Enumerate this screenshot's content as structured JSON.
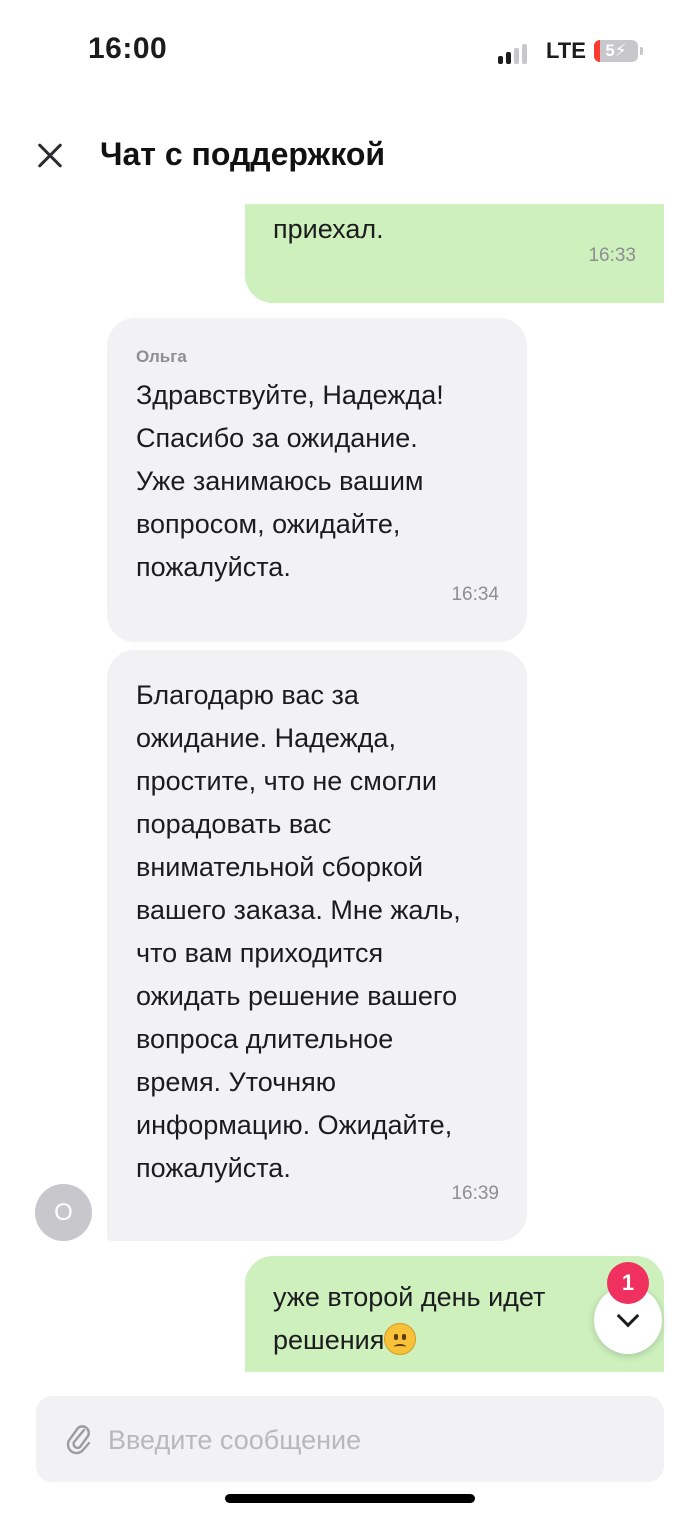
{
  "status_bar": {
    "time": "16:00",
    "network": "LTE",
    "battery": "5",
    "battery_level_percent": 5
  },
  "header": {
    "title": "Чат с поддержкой",
    "close_icon": "close-icon"
  },
  "messages": [
    {
      "direction": "outgoing",
      "text": "приехал.",
      "time": "16:33"
    },
    {
      "direction": "incoming",
      "sender": "Ольга",
      "text": "Здравствуйте, Надежда!\nСпасибо за ожидание.\nУже занимаюсь вашим\nвопросом, ожидайте,\nпожалуйста.",
      "time": "16:34"
    },
    {
      "direction": "incoming",
      "text": "Благодарю вас за\nожидание. Надежда,\nпростите, что не смогли\nпорадовать вас\nвнимательной сборкой\nвашего заказа. Мне жаль,\nчто вам приходится\nожидать решение вашего\nвопроса длительное\nвремя. Уточняю\nинформацию. Ожидайте,\nпожалуйста.",
      "time": "16:39"
    },
    {
      "direction": "outgoing",
      "text": "уже второй день идет\nрешения",
      "emoji": "slightly-frowning-face"
    }
  ],
  "avatar": {
    "initial": "О",
    "color": "#c7c7cc"
  },
  "scroll_button": {
    "unread_count": "1",
    "icon": "chevron-down-icon"
  },
  "composer": {
    "placeholder": "Введите сообщение",
    "value": "",
    "attach_icon": "paperclip-icon"
  },
  "colors": {
    "outgoing_bubble": "#cdf0bd",
    "incoming_bubble": "#f2f2f4",
    "badge": "#f0305f"
  }
}
